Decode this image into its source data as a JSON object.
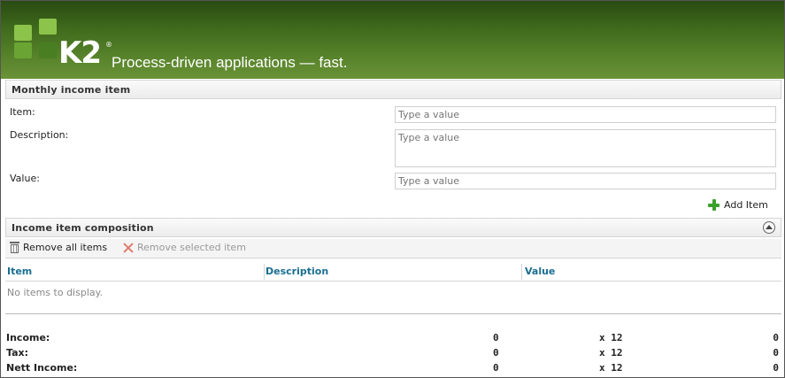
{
  "header": {
    "brand": "K2",
    "trademark": "®",
    "tagline": "Process-driven applications — fast."
  },
  "form": {
    "section_title": "Monthly income item",
    "fields": [
      {
        "label": "Item:",
        "placeholder": "Type a value",
        "value": ""
      },
      {
        "label": "Description:",
        "placeholder": "Type a value",
        "value": ""
      },
      {
        "label": "Value:",
        "placeholder": "Type a value",
        "value": ""
      }
    ],
    "add_item_label": "Add Item"
  },
  "composition": {
    "section_title": "Income item composition",
    "toolbar": {
      "remove_all_label": "Remove all items",
      "remove_selected_label": "Remove selected item"
    },
    "columns": [
      "Item",
      "Description",
      "Value"
    ],
    "empty_message": "No items to display."
  },
  "summary": [
    {
      "label": "Income:",
      "amount": "0",
      "multiplier": "x 12",
      "total": "0"
    },
    {
      "label": "Tax:",
      "amount": "0",
      "multiplier": "x 12",
      "total": "0"
    },
    {
      "label": "Nett Income:",
      "amount": "0",
      "multiplier": "x 12",
      "total": "0"
    }
  ],
  "colors": {
    "header_green": "#3f6a1c",
    "column_header_text": "#1a6e91",
    "add_icon_green": "#3aa12a",
    "remove_icon_red": "#e07a6a"
  }
}
